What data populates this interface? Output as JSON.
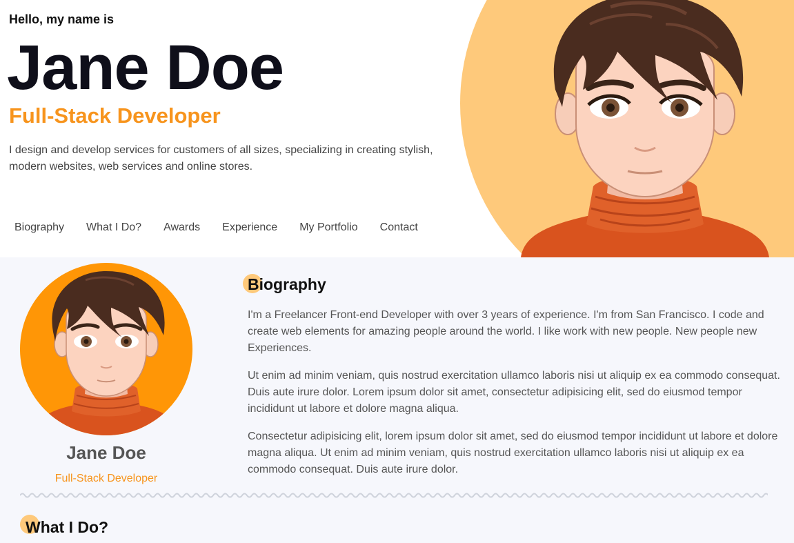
{
  "hero": {
    "greeting": "Hello, my name is",
    "name": "Jane Doe",
    "role": "Full-Stack Developer",
    "description": "I design and develop services for customers of all sizes, specializing in creating stylish, modern websites, web services and online stores."
  },
  "nav": {
    "items": [
      "Biography",
      "What I Do?",
      "Awards",
      "Experience",
      "My Portfolio",
      "Contact"
    ]
  },
  "profile": {
    "name": "Jane Doe",
    "role": "Full-Stack Developer"
  },
  "biography": {
    "title": "Biography",
    "paragraphs": [
      "I'm a Freelancer Front-end Developer with over 3 years of experience. I'm from San Francisco. I code and create web elements for amazing people around the world. I like work with new people. New people new Experiences.",
      "Ut enim ad minim veniam, quis nostrud exercitation ullamco laboris nisi ut aliquip ex ea commodo consequat. Duis aute irure dolor. Lorem ipsum dolor sit amet, consectetur adipisicing elit, sed do eiusmod tempor incididunt ut labore et dolore magna aliqua.",
      "Consectetur adipisicing elit, lorem ipsum dolor sit amet, sed do eiusmod tempor incididunt ut labore et dolore magna aliqua. Ut enim ad minim veniam, quis nostrud exercitation ullamco laboris nisi ut aliquip ex ea commodo consequat. Duis aute irure dolor."
    ]
  },
  "what_i_do": {
    "title": "What I Do?"
  },
  "colors": {
    "accent": "#f7941d",
    "hero_blob": "#fec97b",
    "avatar_bg": "#ff9606",
    "content_bg": "#f6f7fc"
  }
}
